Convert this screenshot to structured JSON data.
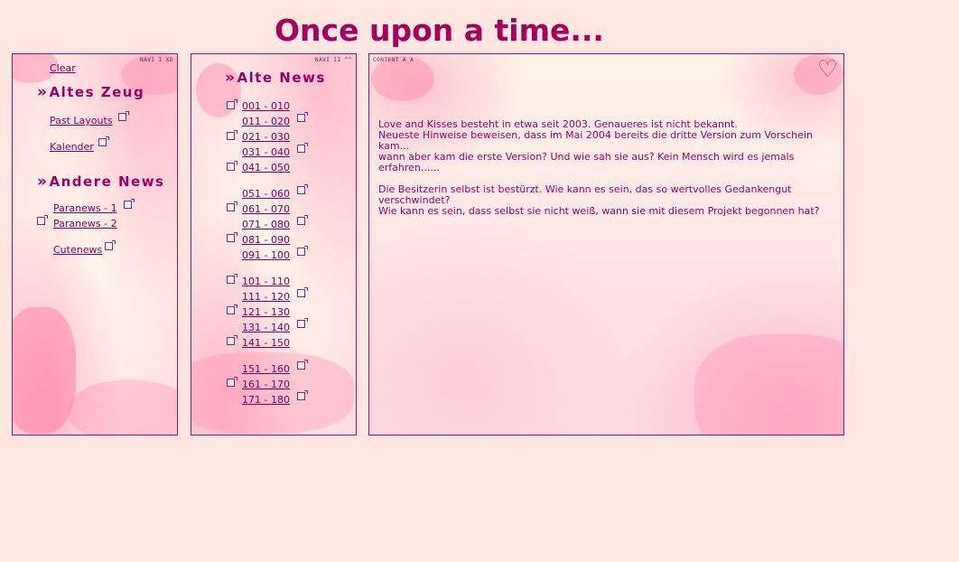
{
  "page": {
    "title": "Once upon a time..."
  },
  "navi1": {
    "tag": "NAVI I XD",
    "clear": "Clear",
    "heading1": "Altes Zeug",
    "heading2": "Andere News",
    "links": {
      "past_layouts": "Past Layouts",
      "kalender": "Kalender",
      "paranews1": "Paranews - 1",
      "paranews2": "Paranews - 2",
      "cutenews": "Cutenews"
    }
  },
  "navi2": {
    "tag": "NAVI II ^^",
    "heading": "Alte News",
    "groups": [
      [
        "001 - 010",
        "011 - 020",
        "021 - 030",
        "031 - 040",
        "041 - 050"
      ],
      [
        "051 - 060",
        "061 - 070",
        "071 - 080",
        "081 - 090",
        "091 - 100"
      ],
      [
        "101 - 110",
        "111 - 120",
        "121 - 130",
        "131 - 140",
        "141 - 150"
      ],
      [
        "151 - 160",
        "161 - 170",
        "171 - 180"
      ]
    ]
  },
  "content": {
    "tag": "CONTENT A_A",
    "lines": [
      "Love and Kisses besteht in etwa seit 2003. Genaueres ist nicht bekannt.",
      "Neueste Hinweise beweisen, dass im Mai 2004 bereits die dritte Version zum Vorschein kam...",
      "wann aber kam die erste Version? Und wie sah sie aus? Kein Mensch wird es jemals erfahren......",
      "",
      "Die Besitzerin selbst ist bestürzt. Wie kann es sein, das so wertvolles Gedankengut verschwindet?",
      "Wie kann es sein, dass selbst sie nicht weiß, wann sie mit diesem Projekt begonnen hat?"
    ]
  },
  "colors": {
    "background": "#ffe6e1",
    "accent": "#990066",
    "title": "#a6005a",
    "border": "#8a1a6a"
  }
}
